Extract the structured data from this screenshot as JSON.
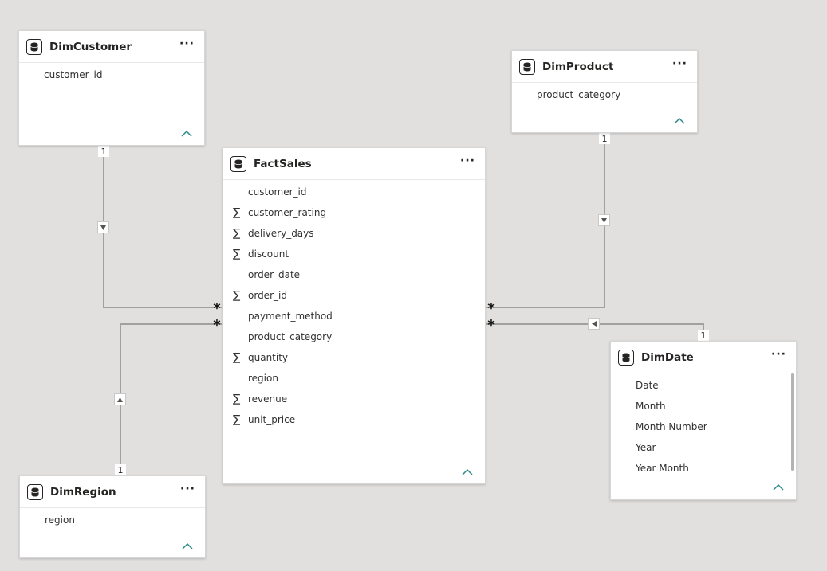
{
  "tables": {
    "dimcustomer": {
      "name": "DimCustomer",
      "fields": [
        "customer_id"
      ]
    },
    "dimproduct": {
      "name": "DimProduct",
      "fields": [
        "product_category"
      ]
    },
    "factsales": {
      "name": "FactSales",
      "fields": [
        {
          "name": "customer_id",
          "sum": false
        },
        {
          "name": "customer_rating",
          "sum": true
        },
        {
          "name": "delivery_days",
          "sum": true
        },
        {
          "name": "discount",
          "sum": true
        },
        {
          "name": "order_date",
          "sum": false
        },
        {
          "name": "order_id",
          "sum": true
        },
        {
          "name": "payment_method",
          "sum": false
        },
        {
          "name": "product_category",
          "sum": false
        },
        {
          "name": "quantity",
          "sum": true
        },
        {
          "name": "region",
          "sum": false
        },
        {
          "name": "revenue",
          "sum": true
        },
        {
          "name": "unit_price",
          "sum": true
        }
      ]
    },
    "dimdate": {
      "name": "DimDate",
      "fields": [
        "Date",
        "Month",
        "Month Number",
        "Year",
        "Year Month"
      ]
    },
    "dimregion": {
      "name": "DimRegion",
      "fields": [
        "region"
      ]
    }
  },
  "ui": {
    "more_label": "···",
    "sigma": "∑"
  },
  "relationships": {
    "one_label": "1",
    "many_label": "*"
  },
  "colors": {
    "line": "#a0a0a0",
    "accent": "#2a8a8a",
    "background": "#e1e0de"
  }
}
